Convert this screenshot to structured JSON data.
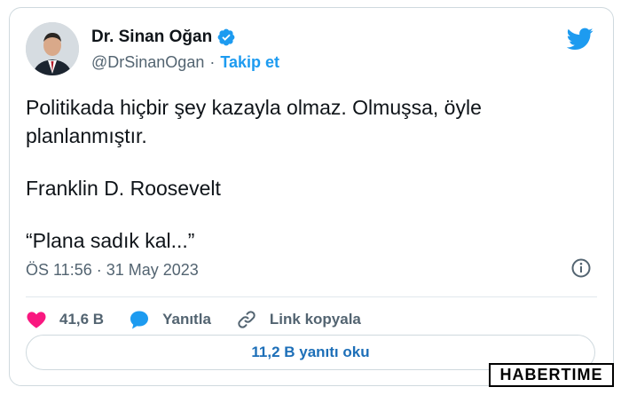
{
  "tweet": {
    "display_name": "Dr. Sinan Oğan",
    "handle": "@DrSinanOgan",
    "separator": "·",
    "follow_label": "Takip et",
    "text_lines": [
      "Politikada hiçbir şey kazayla olmaz. Olmuşsa, öyle",
      "planlanmıştır.",
      "Franklin D. Roosevelt",
      "“Plana sadık kal...”"
    ],
    "timestamp": "ÖS 11:56 · 31 May 2023",
    "likes_label": "41,6 B",
    "reply_label": "Yanıtla",
    "copy_link_label": "Link kopyala",
    "read_replies_label": "11,2 B yanıtı oku"
  },
  "icons": {
    "verified": "verified-badge-icon",
    "brand": "twitter-bird-icon",
    "info": "info-icon",
    "like": "heart-icon",
    "reply": "speech-bubble-icon",
    "link": "link-icon"
  },
  "colors": {
    "accent": "#1d9bf0",
    "like": "#f91880",
    "muted": "#536471",
    "text": "#0f1419"
  },
  "watermark": {
    "text": "HABERTIME"
  }
}
